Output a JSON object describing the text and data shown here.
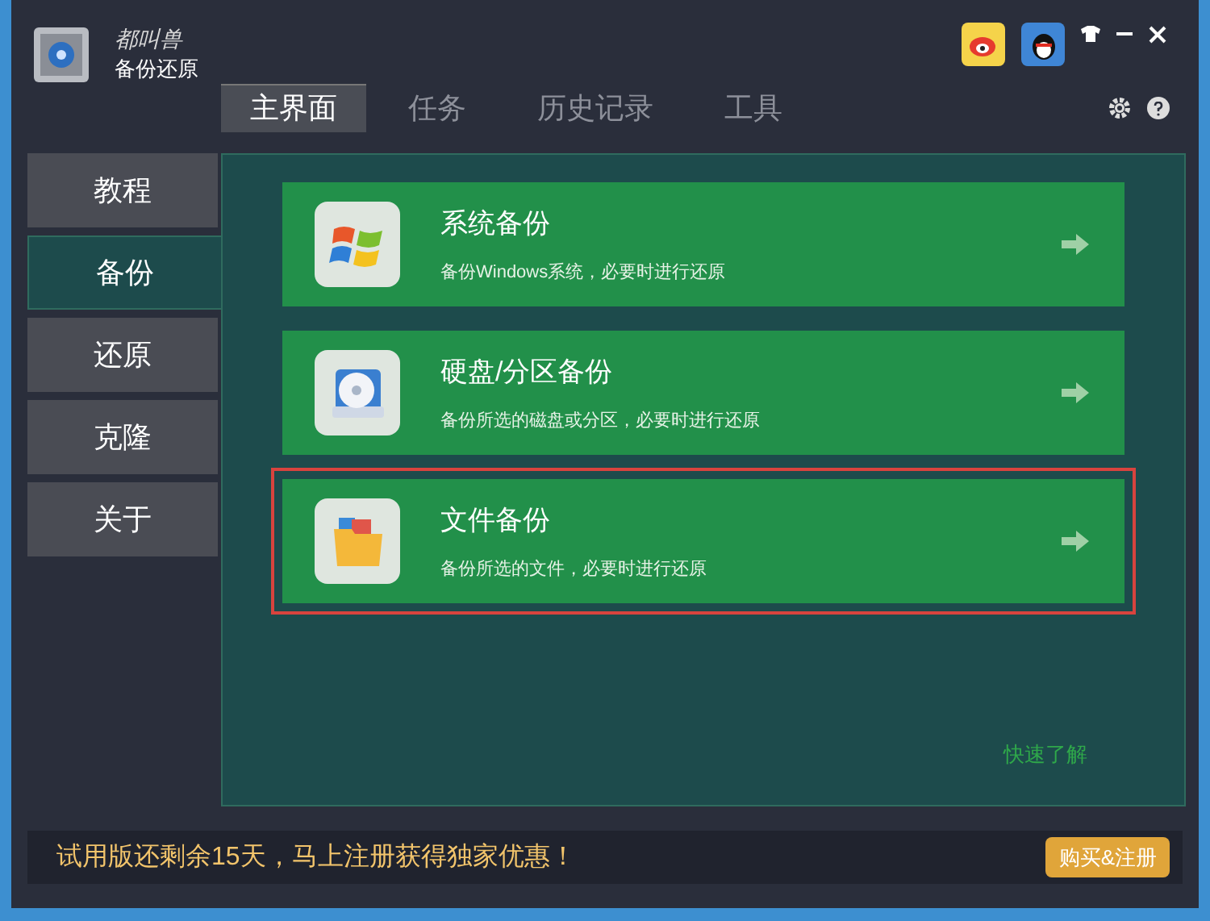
{
  "app": {
    "brand": "都叫兽",
    "title": "备份还原"
  },
  "tabs": [
    {
      "label": "主界面",
      "selected": true
    },
    {
      "label": "任务",
      "selected": false
    },
    {
      "label": "历史记录",
      "selected": false
    },
    {
      "label": "工具",
      "selected": false
    }
  ],
  "sidebar": {
    "items": [
      {
        "label": "教程",
        "selected": false
      },
      {
        "label": "备份",
        "selected": true
      },
      {
        "label": "还原",
        "selected": false
      },
      {
        "label": "克隆",
        "selected": false
      },
      {
        "label": "关于",
        "selected": false
      }
    ]
  },
  "cards": [
    {
      "kind": "windows",
      "title": "系统备份",
      "description": "备份Windows系统，必要时进行还原",
      "highlighted": false
    },
    {
      "kind": "disk",
      "title": "硬盘/分区备份",
      "description": "备份所选的磁盘或分区，必要时进行还原",
      "highlighted": false
    },
    {
      "kind": "folder",
      "title": "文件备份",
      "description": "备份所选的文件，必要时进行还原",
      "highlighted": true
    }
  ],
  "quick_link": "快速了解",
  "status_bar": {
    "message": "试用版还剩余15天，马上注册获得独家优惠！",
    "button": "购买&注册"
  }
}
